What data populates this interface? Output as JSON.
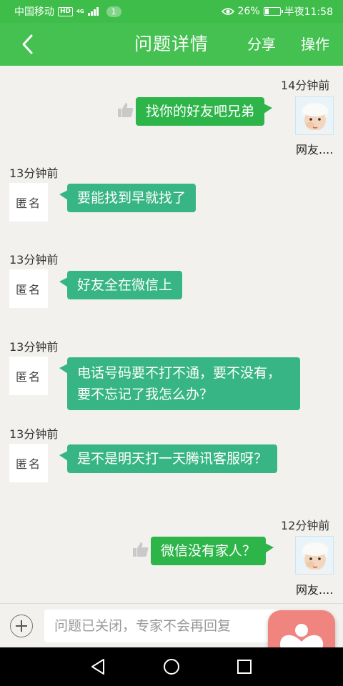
{
  "status_bar": {
    "carrier": "中国移动",
    "hd": "HD",
    "network": "4G",
    "notification_count": "1",
    "battery_percent": "26%",
    "battery_level": 0.26,
    "time": "半夜11:58"
  },
  "nav": {
    "title": "问题详情",
    "share_label": "分享",
    "operate_label": "操作"
  },
  "messages": [
    {
      "time": "14分钟前",
      "text": "找你的好友吧兄弟",
      "side": "right",
      "user": "网友...."
    },
    {
      "time": "13分钟前",
      "text": "要能找到早就找了",
      "side": "left",
      "user": "匿名"
    },
    {
      "time": "13分钟前",
      "text": "好友全在微信上",
      "side": "left",
      "user": "匿名"
    },
    {
      "time": "13分钟前",
      "text": "电话号码要不打不通，要不没有，要不忘记了我怎么办？",
      "side": "left",
      "user": "匿名"
    },
    {
      "time": "13分钟前",
      "text": "是不是明天打一天腾讯客服呀？",
      "side": "left",
      "user": "匿名"
    },
    {
      "time": "12分钟前",
      "text": "微信没有家人？",
      "side": "right",
      "user": "网友...."
    }
  ],
  "input": {
    "placeholder": "问题已关闭，专家不会再回复"
  },
  "colors": {
    "header": "#44c150",
    "status_bar": "#3fbd4b",
    "own_bubble": "#2db54a",
    "other_bubble": "#38b585",
    "background": "#f2f1ee"
  },
  "icons": [
    "back-arrow-icon",
    "like-icon",
    "plus-icon",
    "heart-app-icon",
    "nav-back-icon",
    "nav-home-icon",
    "nav-recent-icon"
  ]
}
